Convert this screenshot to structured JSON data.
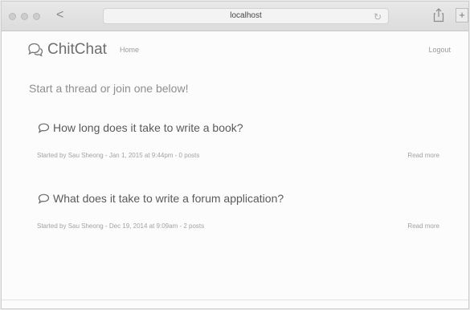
{
  "browser": {
    "url": "localhost",
    "back_label": "<",
    "reload_label": "↻",
    "newtab_label": "+"
  },
  "navbar": {
    "brand": "ChitChat",
    "home_label": "Home",
    "logout_label": "Logout"
  },
  "main": {
    "lead": "Start a thread or join one below!",
    "threads": [
      {
        "title": "How long does it take to write a book?",
        "meta": "Started by Sau Sheong - Jan 1, 2015 at 9:44pm - 0 posts",
        "read_more": "Read more"
      },
      {
        "title": "What does it take to write a forum application?",
        "meta": "Started by Sau Sheong - Dec 19, 2014 at 9:09am - 2 posts",
        "read_more": "Read more"
      }
    ]
  },
  "icons": {
    "brand": "chat-bubbles-icon",
    "thread": "speech-bubble-icon",
    "share": "share-icon"
  }
}
